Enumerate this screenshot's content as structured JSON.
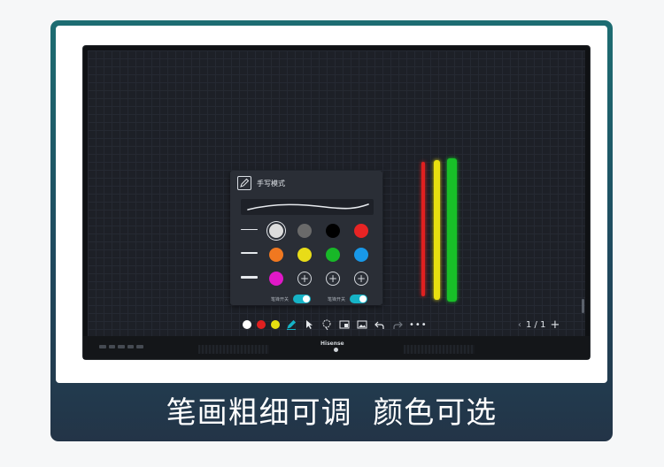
{
  "panel": {
    "title": "手写模式",
    "colors": [
      "#dcdcdc",
      "#6a6a6a",
      "#000000",
      "#e82424",
      "#f07820",
      "#e8dc18",
      "#18b828",
      "#1898e8",
      "#e018c8"
    ],
    "add_symbol": "+",
    "toggle_left_label": "笔锋开关",
    "toggle_right_label": "笔锋开关",
    "toggle_left_on": true,
    "toggle_right_on": true,
    "accent": "#16b3c6"
  },
  "bars": [
    {
      "color": "#e02020"
    },
    {
      "color": "#e8e010"
    },
    {
      "color": "#18c028"
    }
  ],
  "toolbar": {
    "colors": [
      "#ffffff",
      "#e02020",
      "#e8e010"
    ],
    "icons": [
      "pen-icon",
      "cursor-icon",
      "lasso-icon",
      "insert-page-icon",
      "image-icon",
      "undo-icon",
      "redo-icon",
      "more-icon"
    ],
    "more_label": "•••"
  },
  "pager": {
    "prev": "‹",
    "text": "1 / 1",
    "add": "+"
  },
  "monitor": {
    "brand": "Hisense"
  },
  "caption": "笔画粗细可调  颜色可选"
}
